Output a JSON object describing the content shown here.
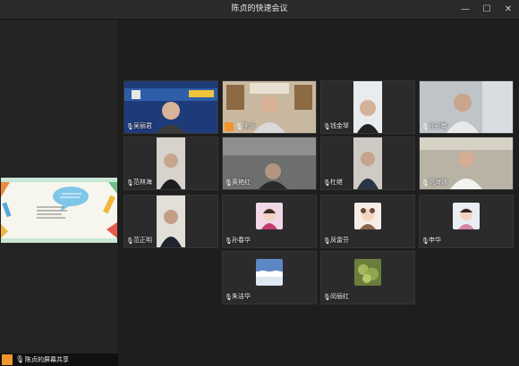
{
  "window": {
    "title": "陈贞的快速会议",
    "minimize_glyph": "—",
    "maximize_glyph": "☐",
    "close_glyph": "✕"
  },
  "share": {
    "label": "陈贞的屏幕共享"
  },
  "participants": [
    {
      "name": "吴丽君"
    },
    {
      "name": "陈贞"
    },
    {
      "name": "钱金琴"
    },
    {
      "name": "孙裕敏"
    },
    {
      "name": "范林海"
    },
    {
      "name": "黄艳红"
    },
    {
      "name": "杜继"
    },
    {
      "name": "姚海娜"
    },
    {
      "name": "范正明"
    },
    {
      "name": "孙春华"
    },
    {
      "name": "凤雷芬"
    },
    {
      "name": "申华"
    },
    {
      "name": "朱洁华"
    },
    {
      "name": "闵丽红"
    }
  ],
  "colors": {
    "host_badge": "#f0962d",
    "background": "#1e1e1e"
  }
}
